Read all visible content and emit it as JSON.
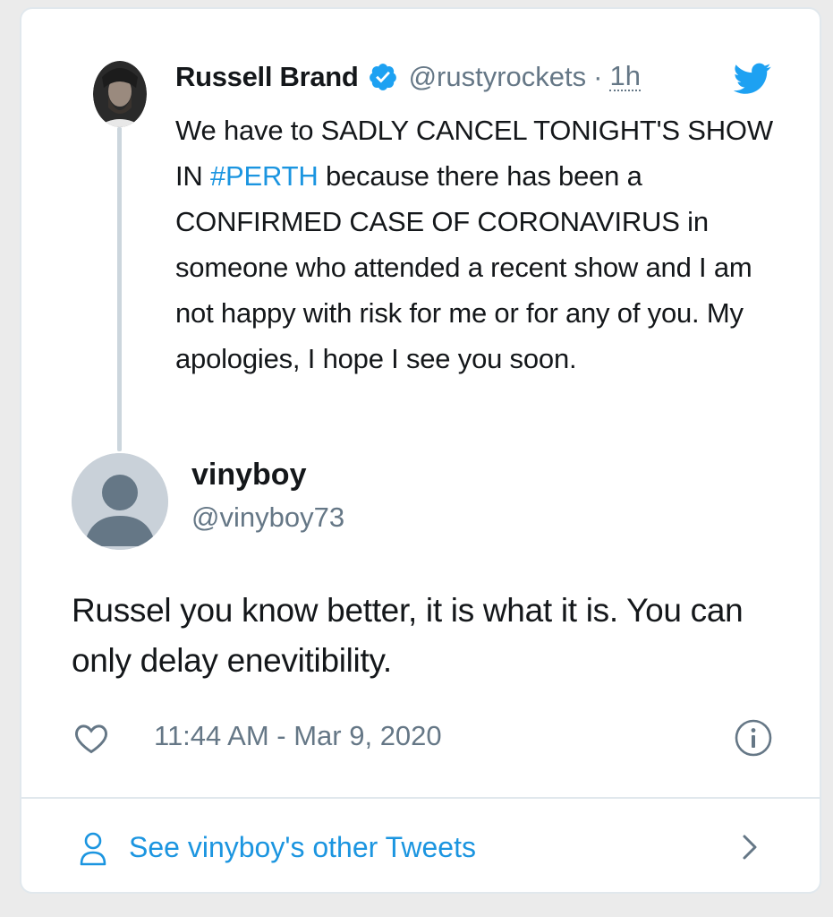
{
  "parent_tweet": {
    "name": "Russell Brand",
    "handle": "@rustyrockets",
    "separator": "·",
    "time": "1h",
    "text_before_hashtag": "We have to SADLY CANCEL TONIGHT'S SHOW IN ",
    "hashtag": "#PERTH",
    "text_after_hashtag": " because there has been a CONFIRMED CASE OF CORONAVIRUS in someone who attended a recent show and I am not happy with risk for me or for any of you. My apologies, I hope I see you soon.",
    "verified": true
  },
  "reply_tweet": {
    "name": "vinyboy",
    "handle": "@vinyboy73",
    "text": "Russel you know better, it is what it is. You can only delay enevitibility.",
    "timestamp": "11:44 AM - Mar 9, 2020"
  },
  "footer": {
    "link_label": "See vinyboy's other Tweets"
  },
  "icons": {
    "verified": "verified-badge-icon",
    "bird": "twitter-bird-icon",
    "heart": "heart-icon",
    "info": "info-icon",
    "person": "person-icon",
    "chevron": "chevron-right-icon"
  },
  "colors": {
    "accent": "#1da1f2",
    "link": "#1b95e0",
    "muted": "#657786",
    "text": "#14171a",
    "border": "#e1e8ed"
  }
}
